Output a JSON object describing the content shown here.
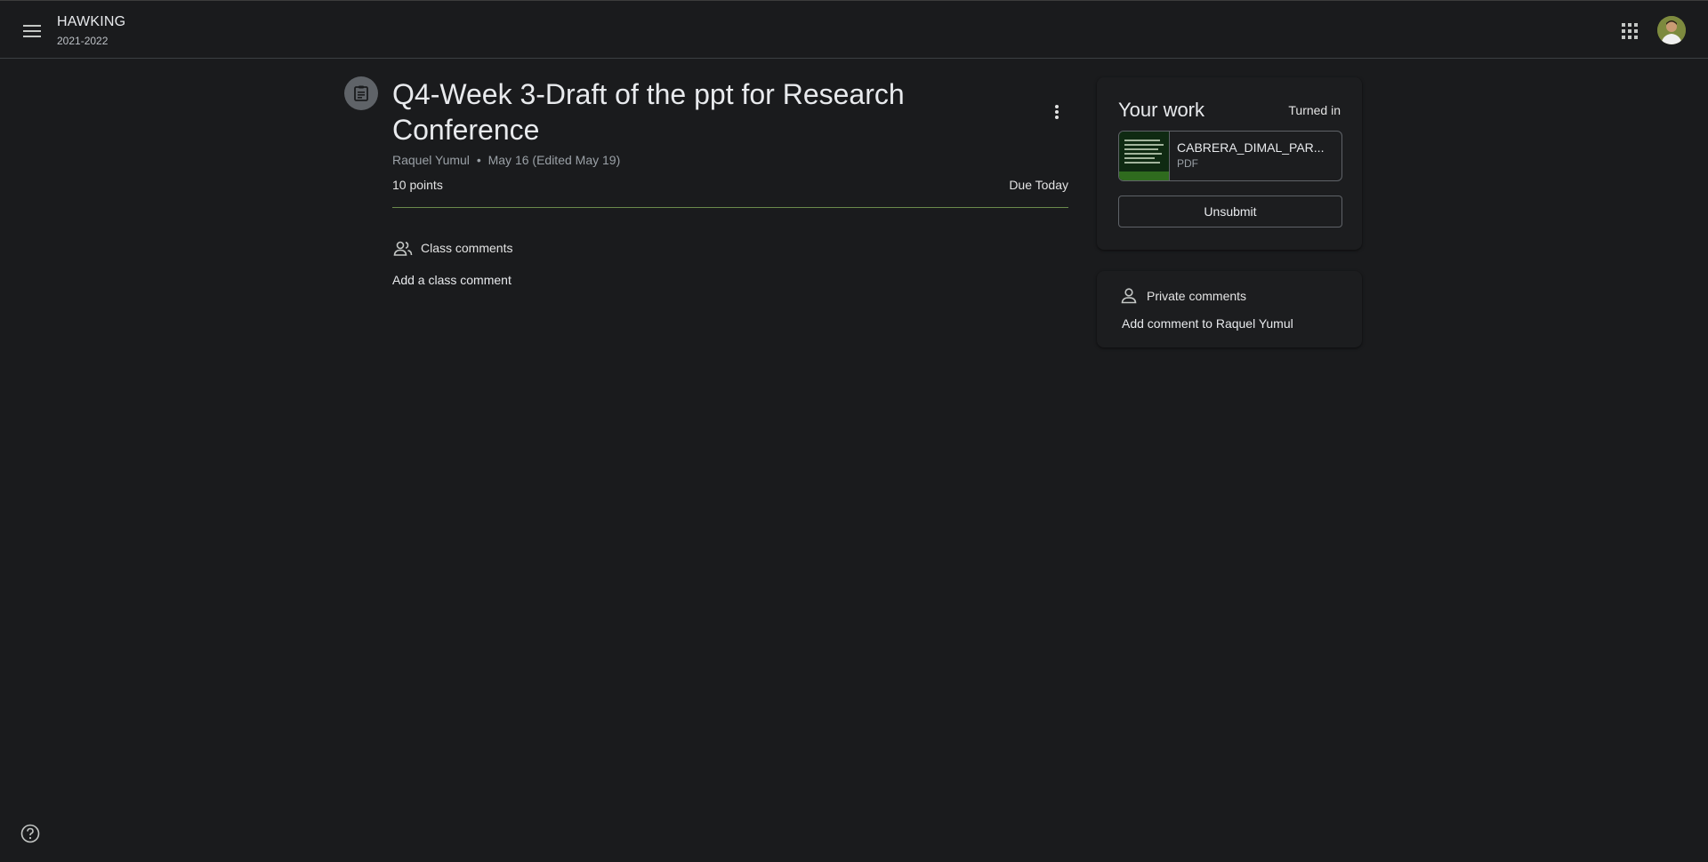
{
  "header": {
    "menu_icon": "hamburger-menu-icon",
    "class_name": "HAWKING",
    "class_section": "2021-2022",
    "apps_icon": "google-apps-grid-icon",
    "avatar_icon": "user-avatar"
  },
  "assignment": {
    "icon": "assignment-icon",
    "title": "Q4-Week 3-Draft of the ppt for Research Conference",
    "author": "Raquel Yumul",
    "separator": "•",
    "date": "May 16 (Edited May 19)",
    "points": "10 points",
    "due": "Due Today",
    "accent_color": "#6a8a4c"
  },
  "class_comments": {
    "label": "Class comments",
    "add_label": "Add a class comment"
  },
  "your_work": {
    "title": "Your work",
    "status": "Turned in",
    "attachment": {
      "name": "CABRERA_DIMAL_PAR...",
      "type": "PDF"
    },
    "unsubmit_label": "Unsubmit"
  },
  "private_comments": {
    "label": "Private comments",
    "add_label": "Add comment to Raquel Yumul"
  },
  "footer": {
    "help_icon": "help-icon"
  }
}
